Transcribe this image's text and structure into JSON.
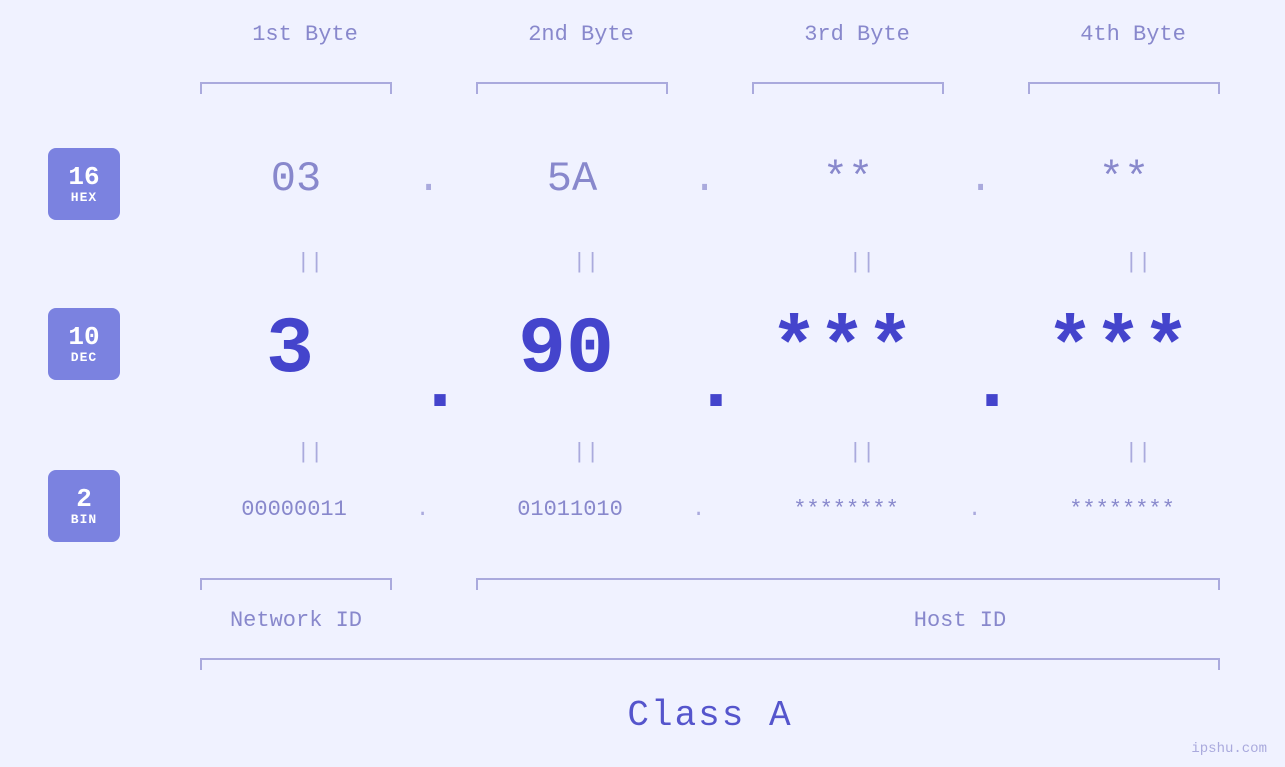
{
  "badges": {
    "hex": {
      "num": "16",
      "label": "HEX"
    },
    "dec": {
      "num": "10",
      "label": "DEC"
    },
    "bin": {
      "num": "2",
      "label": "BIN"
    }
  },
  "columns": {
    "headers": [
      "1st Byte",
      "2nd Byte",
      "3rd Byte",
      "4th Byte"
    ]
  },
  "rows": {
    "hex": {
      "values": [
        "03",
        "5A",
        "**",
        "**"
      ],
      "dots": [
        ".",
        ".",
        "."
      ]
    },
    "dec": {
      "values": [
        "3",
        "90",
        "***",
        "***"
      ],
      "dots": [
        ".",
        ".",
        "."
      ]
    },
    "bin": {
      "values": [
        "00000011",
        "01011010",
        "********",
        "********"
      ],
      "dots": [
        ".",
        ".",
        "."
      ]
    }
  },
  "equals": "||",
  "labels": {
    "network_id": "Network ID",
    "host_id": "Host ID",
    "class": "Class A"
  },
  "watermark": "ipshu.com"
}
